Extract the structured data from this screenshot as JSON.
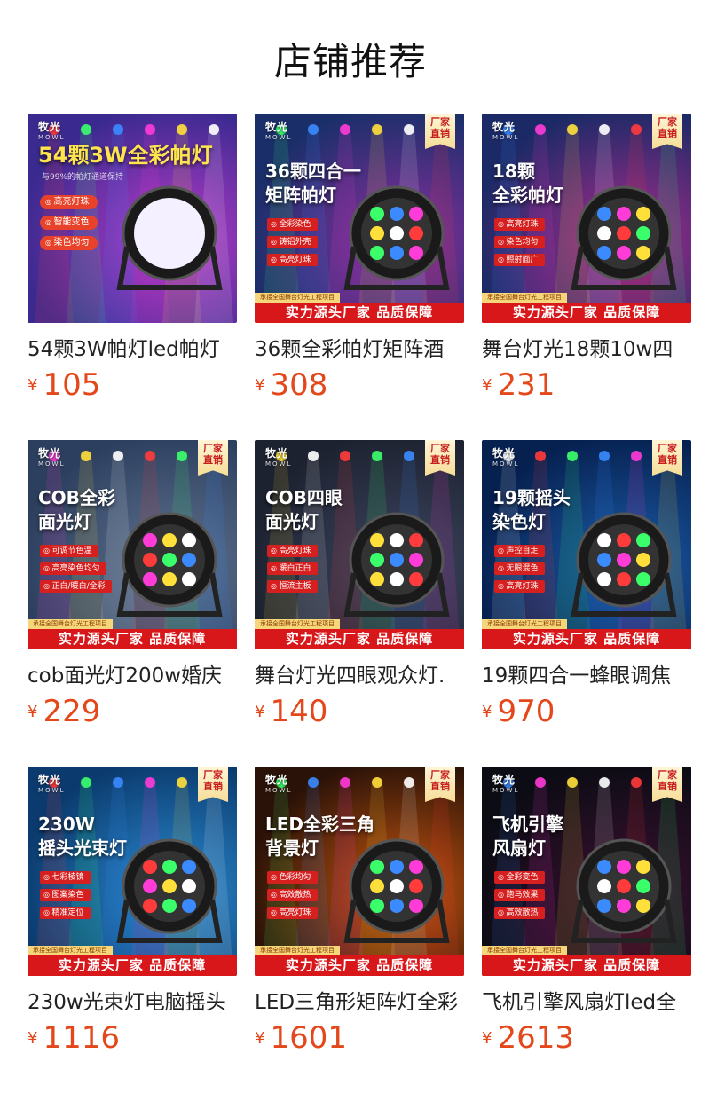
{
  "page": {
    "title": "店铺推荐"
  },
  "brand": {
    "name": "牧光",
    "en": "MOWL"
  },
  "badge": {
    "factory_direct": "厂家\n直销"
  },
  "strip": {
    "small": "承接全国舞台灯光工程项目",
    "bar": "实力源头厂家 品质保障"
  },
  "currency": "¥",
  "products": [
    {
      "headline": "54颗3W全彩帕灯",
      "subline": "与99%的帕灯通道保持",
      "features": [
        "高亮灯珠",
        "智能变色",
        "染色均匀"
      ],
      "name": "54颗3W帕灯led帕灯",
      "price": "105",
      "colors": {
        "bg1": "#3a2a8f",
        "bg2": "#b83bc9"
      }
    },
    {
      "headline": "36颗四合一\n矩阵帕灯",
      "features": [
        "全彩染色",
        "铸铝外壳",
        "高亮灯珠"
      ],
      "name": "36颗全彩帕灯矩阵酒",
      "price": "308",
      "colors": {
        "bg1": "#1a2f6a",
        "bg2": "#8a2f9e"
      }
    },
    {
      "headline": "18颗\n全彩帕灯",
      "features": [
        "高亮灯珠",
        "染色均匀",
        "照射面广"
      ],
      "name": "舞台灯光18颗10w四",
      "price": "231",
      "colors": {
        "bg1": "#1b2a66",
        "bg2": "#a82c8e"
      }
    },
    {
      "headline": "COB全彩\n面光灯",
      "features": [
        "可调节色温",
        "高亮染色均匀",
        "正白/暖白/全彩"
      ],
      "name": "cob面光灯200w婚庆",
      "price": "229",
      "colors": {
        "bg1": "#2d3f5e",
        "bg2": "#5e7390"
      }
    },
    {
      "headline": "COB四眼\n面光灯",
      "features": [
        "高亮灯珠",
        "暖白正白",
        "恒流主板"
      ],
      "name": "舞台灯光四眼观众灯.",
      "price": "140",
      "colors": {
        "bg1": "#1d2230",
        "bg2": "#3d4660"
      }
    },
    {
      "headline": "19颗摇头\n染色灯",
      "features": [
        "声控自走",
        "无限混色",
        "高亮灯珠"
      ],
      "name": "19颗四合一蜂眼调焦",
      "price": "970",
      "colors": {
        "bg1": "#06204f",
        "bg2": "#1b5ca8"
      }
    },
    {
      "headline": "230W\n摇头光束灯",
      "features": [
        "七彩棱镜",
        "图案染色",
        "精准定位"
      ],
      "name": "230w光束灯电脑摇头",
      "price": "1116",
      "colors": {
        "bg1": "#0b3b6e",
        "bg2": "#2a8ad0"
      }
    },
    {
      "headline": "LED全彩三角\n背景灯",
      "features": [
        "色彩均匀",
        "高效散热",
        "高亮灯珠"
      ],
      "name": "LED三角形矩阵灯全彩",
      "price": "1601",
      "colors": {
        "bg1": "#2a1208",
        "bg2": "#c7560f"
      }
    },
    {
      "headline": "飞机引擎\n风扇灯",
      "features": [
        "全彩变色",
        "跑马效果",
        "高效散热"
      ],
      "name": "飞机引擎风扇灯led全",
      "price": "2613",
      "colors": {
        "bg1": "#0c0c14",
        "bg2": "#3a1030"
      }
    }
  ]
}
